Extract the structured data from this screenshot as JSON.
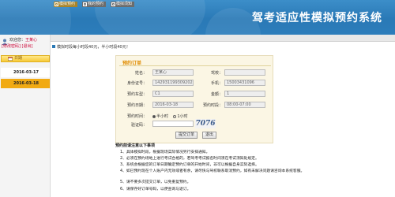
{
  "app": {
    "title": "驾考适应性模拟预约系统"
  },
  "user": {
    "welcome_label": "欢迎您：",
    "name": "王某心",
    "modify_password": "[修改密码]",
    "logout": "[退出]"
  },
  "schedule": {
    "header": "日期",
    "dates": [
      "2016-03-17",
      "2016-03-18"
    ],
    "selected": "2016-03-18"
  },
  "tabs": [
    {
      "label": "模拟预约",
      "active": true
    },
    {
      "label": "我的预约",
      "active": false
    },
    {
      "label": "模拟须知",
      "active": false
    }
  ],
  "notice": "模拟时段每小时段40元，半小时段40元！",
  "form": {
    "title": "预约订单",
    "name_label": "姓名：",
    "name_value": "王某心",
    "category_label": "驾校：",
    "category_value": "",
    "idcard_label": "身份证号：",
    "idcard_value": "142931199309202029",
    "phone_label": "手机：",
    "phone_value": "15003431096",
    "vehicle_label": "预约车型：",
    "vehicle_value": "C1",
    "amount_label": "金额：",
    "amount_value": "1",
    "date_label": "预约日期：",
    "date_value": "2016-03-18",
    "time_label": "预约时段：",
    "time_value": "08:00-07:00",
    "duration_label": "预约时间：",
    "duration_options": [
      "半小时",
      "1小时"
    ],
    "duration_selected": "半小时",
    "captcha_label": "验证码：",
    "captcha_input": "",
    "captcha_image_text": "7076",
    "submit_label": "提交订单",
    "back_label": "退出"
  },
  "notes": {
    "title": "预约前请注意以下事项",
    "items": [
      "1、具体模拟时段，根据现场实际情况另行安排通知。",
      "2、必须在预约场地上进行考试合格的，若驾考考试报名时间须在考试须知处规定。",
      "3、系统会根据您的订单日期确定预约订单的开始时间，非可以根据自身实际选择。",
      "4、如已预约现在个人账户内无效或者有余，请尽快与驾校联系取消预约，如有未解决问题请咨询本系统客服。",
      "5、请不要多次提交订单，以免重复预约。",
      "6、请保存好订单号码，以便查询与退订。"
    ]
  },
  "colors": {
    "header_blue": "#2a79b6",
    "accent_orange": "#f1aa12",
    "panel_bg": "#fbf6e4",
    "title_orange": "#e08c00"
  }
}
